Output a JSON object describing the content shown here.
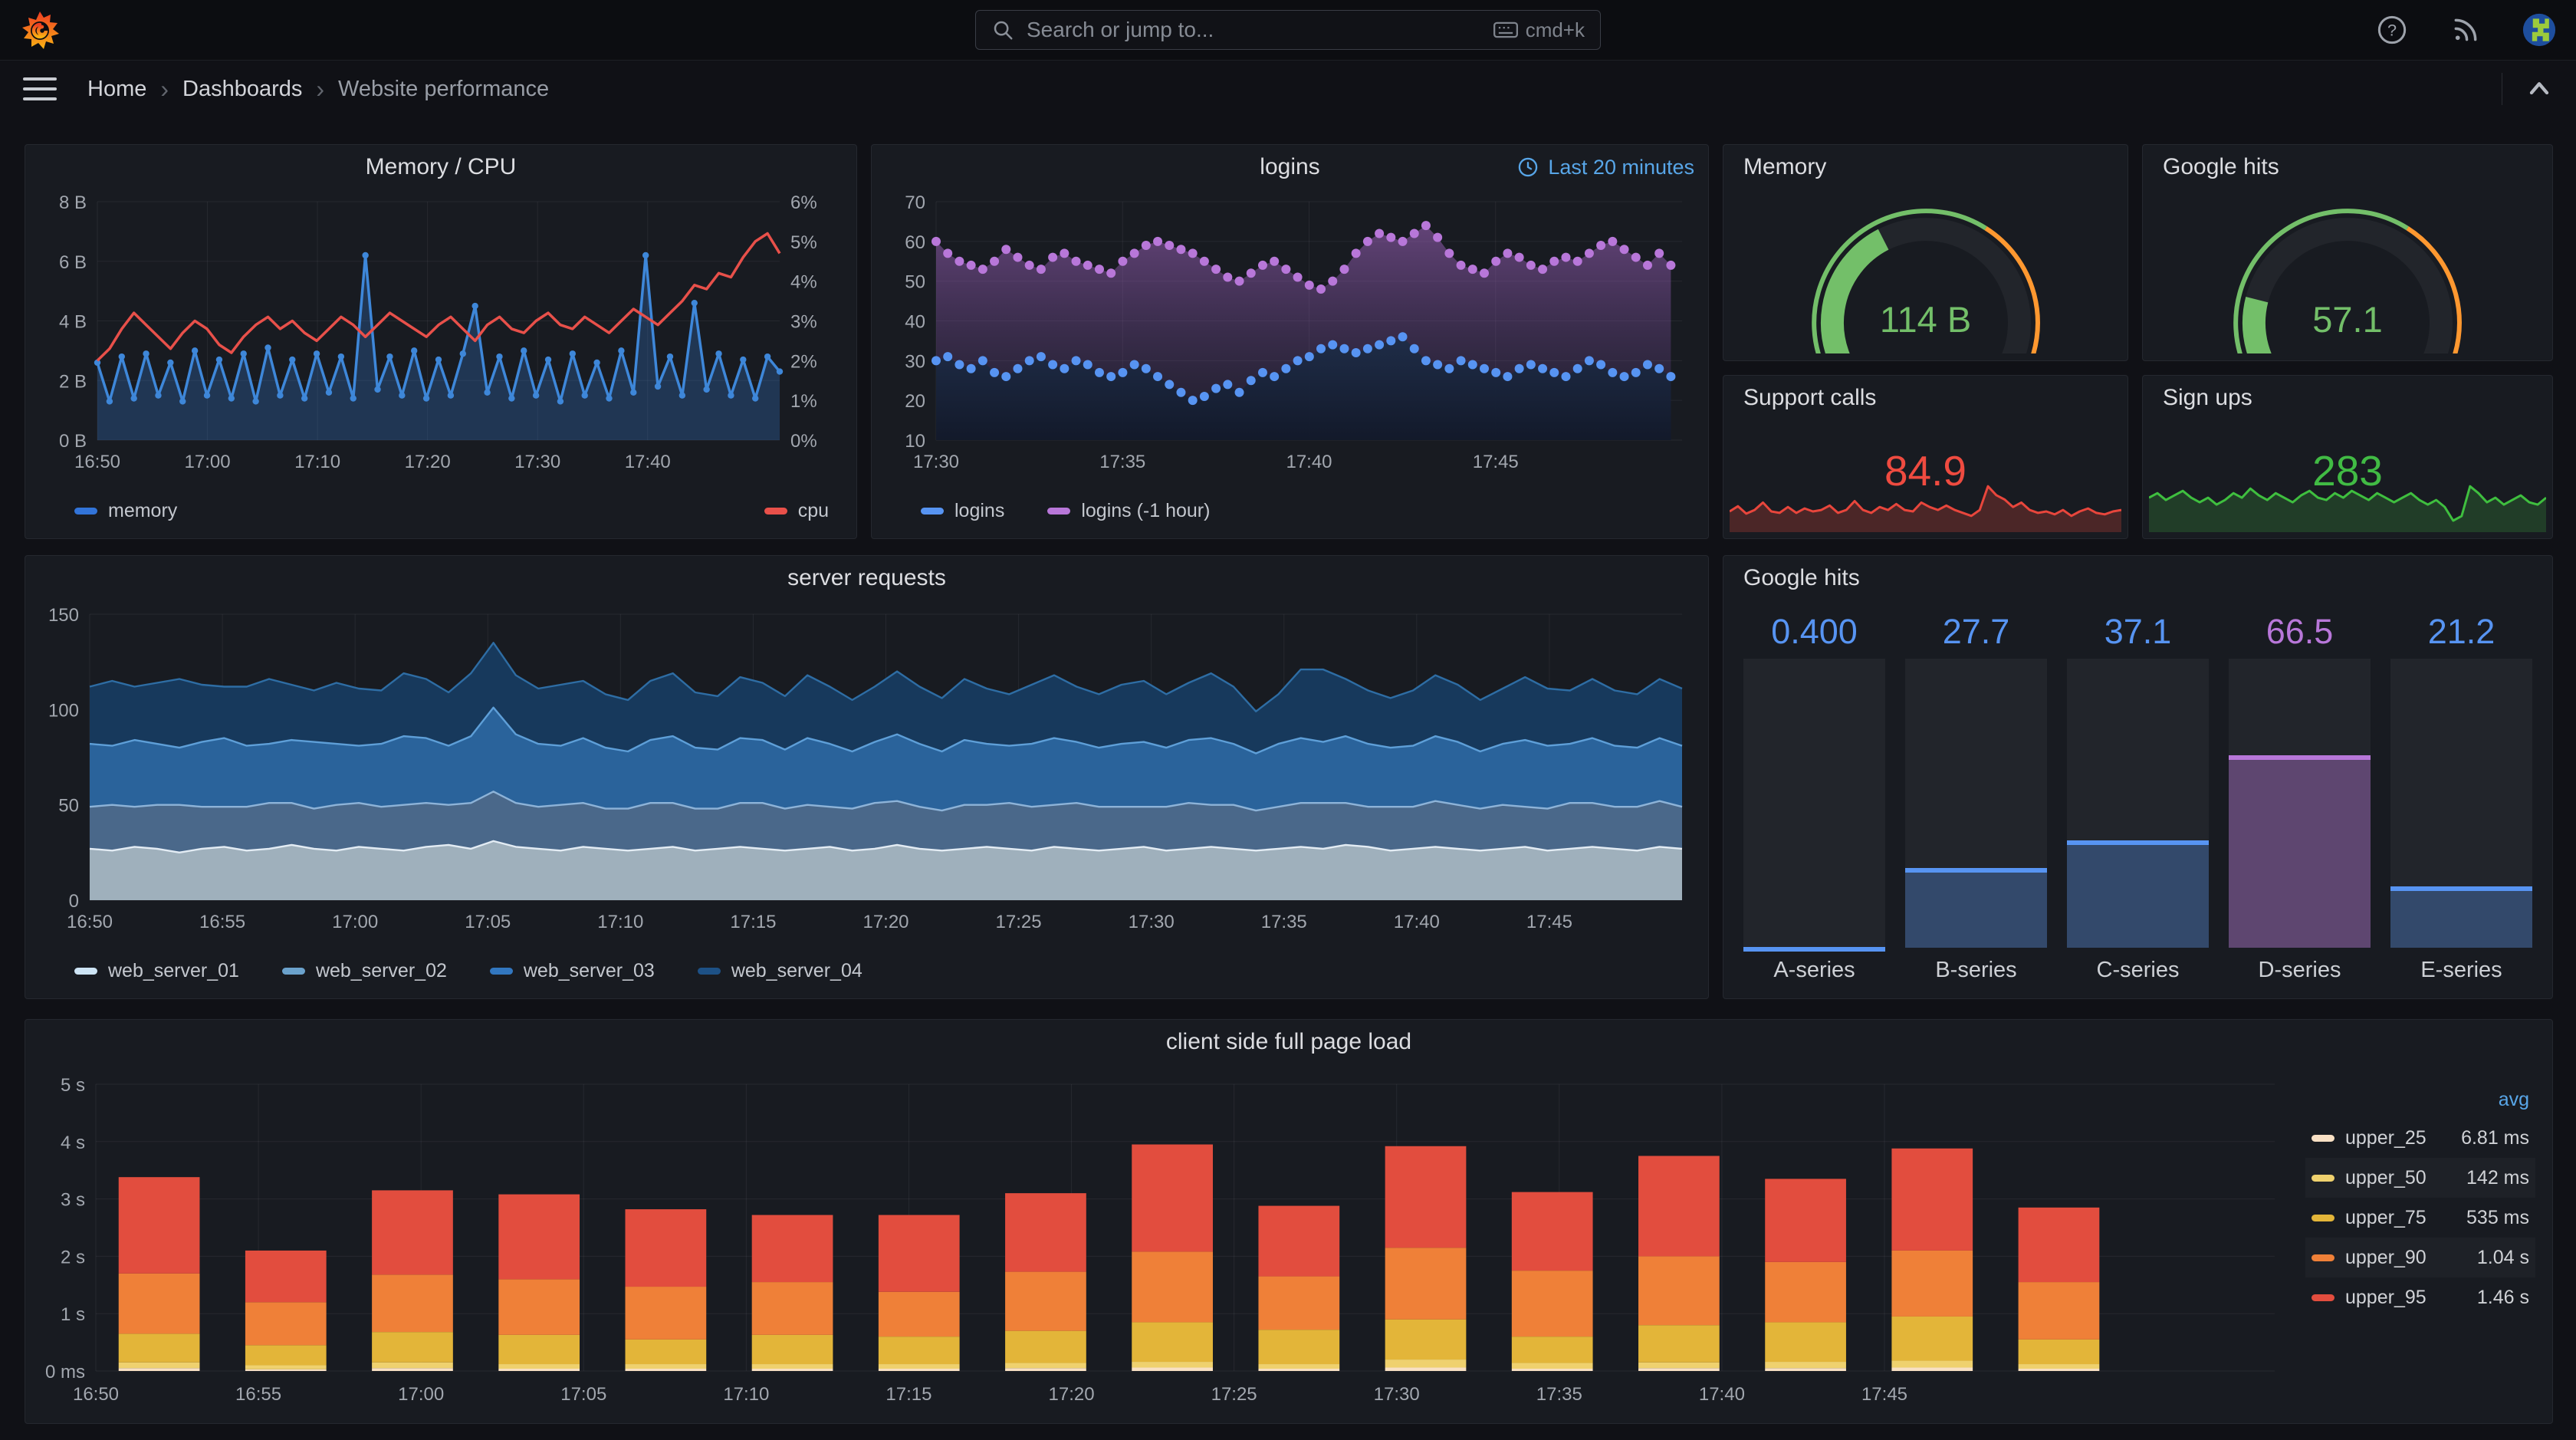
{
  "nav": {
    "search_placeholder": "Search or jump to...",
    "shortcut": "cmd+k",
    "icons": [
      "grafana-logo",
      "help-icon",
      "rss-icon",
      "avatar"
    ]
  },
  "breadcrumb": {
    "items": [
      "Home",
      "Dashboards",
      "Website performance"
    ]
  },
  "colors": {
    "accent_blue": "#58a6e8",
    "green": "#73bf69",
    "orange": "#ff9830",
    "red": "#f2495c",
    "stat_red": "#ef4b40",
    "stat_green": "#41bb44",
    "series_blue": "#5794f2",
    "series_purple": "#b877d9",
    "panel_bg": "#181b21",
    "page_bg": "#101116"
  },
  "chart_data": [
    {
      "id": "memory_cpu",
      "type": "line",
      "title": "Memory / CPU",
      "x_ticks": [
        "16:50",
        "17:00",
        "17:10",
        "17:20",
        "17:30",
        "17:40"
      ],
      "x_tick_minutes": [
        0,
        10,
        20,
        30,
        40,
        50
      ],
      "x_domain_minutes": 62,
      "left_axis": {
        "ticks": [
          "0 B",
          "2 B",
          "4 B",
          "6 B",
          "8 B"
        ],
        "range": [
          0,
          8
        ]
      },
      "right_axis": {
        "ticks": [
          "0%",
          "1%",
          "2%",
          "3%",
          "4%",
          "5%",
          "6%"
        ],
        "range": [
          0,
          6
        ]
      },
      "series": [
        {
          "name": "memory",
          "color": "#3e87d9",
          "axis": "left",
          "values": [
            2.6,
            1.3,
            2.8,
            1.4,
            2.9,
            1.5,
            2.6,
            1.3,
            3.0,
            1.5,
            2.7,
            1.4,
            2.9,
            1.3,
            3.1,
            1.5,
            2.7,
            1.4,
            2.9,
            1.6,
            2.8,
            1.4,
            6.2,
            1.7,
            2.8,
            1.5,
            3.0,
            1.4,
            2.7,
            1.5,
            2.9,
            4.5,
            1.6,
            2.8,
            1.4,
            3.0,
            1.5,
            2.7,
            1.3,
            2.9,
            1.5,
            2.6,
            1.4,
            3.0,
            1.6,
            6.2,
            1.8,
            2.8,
            1.5,
            4.6,
            1.7,
            2.9,
            1.5,
            2.7,
            1.4,
            2.8,
            2.3
          ]
        },
        {
          "name": "cpu",
          "color": "#e8504a",
          "axis": "right",
          "values": [
            2.0,
            2.3,
            2.8,
            3.2,
            2.9,
            2.6,
            2.3,
            2.7,
            3.0,
            2.8,
            2.4,
            2.2,
            2.6,
            2.9,
            3.1,
            2.8,
            3.0,
            2.7,
            2.5,
            2.8,
            3.1,
            2.9,
            2.6,
            2.9,
            3.2,
            3.0,
            2.8,
            2.6,
            2.9,
            3.1,
            2.8,
            2.5,
            2.9,
            3.1,
            2.8,
            2.7,
            3.0,
            3.2,
            2.9,
            2.8,
            3.1,
            2.9,
            2.7,
            3.0,
            3.3,
            3.1,
            2.9,
            3.2,
            3.5,
            3.9,
            3.8,
            4.2,
            4.1,
            4.6,
            5.0,
            5.2,
            4.7
          ]
        }
      ]
    },
    {
      "id": "logins",
      "type": "scatter-area",
      "title": "logins",
      "time_range_label": "Last 20 minutes",
      "x_ticks": [
        "17:30",
        "17:35",
        "17:40",
        "17:45"
      ],
      "x_tick_minutes": [
        0,
        5,
        10,
        15
      ],
      "x_domain_minutes": 20,
      "y_axis": {
        "ticks": [
          "10",
          "20",
          "30",
          "40",
          "50",
          "60",
          "70"
        ],
        "range": [
          10,
          70
        ]
      },
      "series": [
        {
          "name": "logins",
          "color": "#5794f2",
          "values": [
            30,
            31,
            29,
            28,
            30,
            27,
            26,
            28,
            30,
            31,
            29,
            28,
            30,
            29,
            27,
            26,
            27,
            29,
            28,
            26,
            24,
            22,
            20,
            21,
            23,
            24,
            22,
            25,
            27,
            26,
            28,
            30,
            31,
            33,
            34,
            33,
            32,
            33,
            34,
            35,
            36,
            33,
            30,
            29,
            28,
            30,
            29,
            28,
            27,
            26,
            28,
            29,
            28,
            27,
            26,
            28,
            30,
            29,
            27,
            26,
            27,
            29,
            28,
            26
          ]
        },
        {
          "name": "logins (-1 hour)",
          "color": "#b877d9",
          "values": [
            60,
            57,
            55,
            54,
            53,
            55,
            58,
            56,
            54,
            53,
            56,
            57,
            55,
            54,
            53,
            52,
            55,
            57,
            59,
            60,
            59,
            58,
            57,
            55,
            53,
            51,
            50,
            52,
            54,
            55,
            53,
            51,
            49,
            48,
            50,
            53,
            57,
            60,
            62,
            61,
            60,
            62,
            64,
            61,
            57,
            54,
            53,
            52,
            55,
            57,
            56,
            54,
            53,
            55,
            56,
            55,
            57,
            59,
            60,
            58,
            56,
            54,
            57,
            54
          ]
        }
      ]
    },
    {
      "id": "server_requests",
      "type": "area-stacked",
      "title": "server requests",
      "x_ticks": [
        "16:50",
        "16:55",
        "17:00",
        "17:05",
        "17:10",
        "17:15",
        "17:20",
        "17:25",
        "17:30",
        "17:35",
        "17:40",
        "17:45"
      ],
      "x_tick_minutes": [
        0,
        5,
        10,
        15,
        20,
        25,
        30,
        35,
        40,
        45,
        50,
        55
      ],
      "x_domain_minutes": 60,
      "y_axis": {
        "ticks": [
          "0",
          "50",
          "100",
          "150"
        ],
        "range": [
          0,
          150
        ]
      },
      "series": [
        {
          "name": "web_server_01",
          "color": "#9fb0bc",
          "edge": "#e3ecf4",
          "values": [
            27,
            26,
            28,
            27,
            25,
            27,
            28,
            26,
            27,
            29,
            27,
            26,
            28,
            27,
            26,
            28,
            29,
            27,
            31,
            28,
            27,
            26,
            28,
            27,
            26,
            27,
            28,
            26,
            27,
            28,
            27,
            26,
            27,
            28,
            26,
            27,
            29,
            27,
            26,
            27,
            28,
            27,
            26,
            28,
            27,
            26,
            27,
            28,
            26,
            27,
            28,
            27,
            26,
            27,
            28,
            27,
            29,
            28,
            26,
            27,
            28,
            27,
            26,
            27,
            28,
            26,
            27,
            28,
            27,
            26,
            28,
            27
          ]
        },
        {
          "name": "web_server_02",
          "color": "#4a688a",
          "edge": "#8db3d8",
          "values": [
            22,
            24,
            21,
            23,
            25,
            22,
            21,
            23,
            24,
            22,
            21,
            24,
            23,
            22,
            24,
            23,
            21,
            24,
            26,
            23,
            22,
            24,
            23,
            21,
            22,
            24,
            23,
            22,
            21,
            23,
            24,
            22,
            23,
            21,
            22,
            24,
            23,
            22,
            21,
            23,
            22,
            24,
            23,
            22,
            24,
            23,
            22,
            21,
            23,
            24,
            22,
            23,
            21,
            22,
            23,
            24,
            22,
            21,
            23,
            22,
            24,
            23,
            22,
            23,
            21,
            22,
            24,
            23,
            22,
            23,
            24,
            22
          ]
        },
        {
          "name": "web_server_03",
          "color": "#2a639b",
          "edge": "#5e9fd8",
          "values": [
            33,
            31,
            35,
            32,
            30,
            34,
            36,
            32,
            31,
            33,
            35,
            32,
            30,
            33,
            36,
            34,
            31,
            35,
            44,
            36,
            33,
            31,
            34,
            32,
            30,
            33,
            35,
            32,
            31,
            34,
            33,
            31,
            35,
            33,
            30,
            32,
            35,
            33,
            31,
            34,
            32,
            30,
            33,
            35,
            32,
            31,
            33,
            34,
            31,
            33,
            35,
            32,
            30,
            33,
            34,
            32,
            35,
            33,
            31,
            32,
            34,
            33,
            30,
            32,
            35,
            33,
            31,
            34,
            32,
            31,
            33,
            32
          ]
        },
        {
          "name": "web_server_04",
          "color": "#17395c",
          "edge": "#2e6da4",
          "values": [
            30,
            34,
            28,
            32,
            36,
            30,
            27,
            31,
            34,
            29,
            27,
            32,
            30,
            28,
            33,
            31,
            28,
            33,
            34,
            31,
            29,
            32,
            30,
            28,
            27,
            31,
            33,
            29,
            28,
            32,
            30,
            28,
            33,
            30,
            27,
            29,
            33,
            30,
            28,
            32,
            29,
            27,
            31,
            33,
            29,
            28,
            31,
            32,
            28,
            30,
            34,
            30,
            22,
            26,
            36,
            38,
            30,
            28,
            26,
            29,
            32,
            30,
            27,
            29,
            33,
            30,
            28,
            31,
            29,
            28,
            31,
            30
          ]
        }
      ]
    },
    {
      "id": "google_hits_bars",
      "type": "bar-gauge",
      "title": "Google hits",
      "max": 100,
      "categories": [
        "A-series",
        "B-series",
        "C-series",
        "D-series",
        "E-series"
      ],
      "values": [
        0.4,
        27.7,
        37.1,
        66.5,
        21.2
      ],
      "display": [
        "0.400",
        "27.7",
        "37.1",
        "66.5",
        "21.2"
      ],
      "colors": [
        "#5794f2",
        "#5794f2",
        "#5794f2",
        "#b877d9",
        "#5794f2"
      ]
    },
    {
      "id": "client_load",
      "type": "bar-stacked",
      "title": "client side full page load",
      "legend_header": "avg",
      "x_ticks": [
        "16:50",
        "16:55",
        "17:00",
        "17:05",
        "17:10",
        "17:15",
        "17:20",
        "17:25",
        "17:30",
        "17:35",
        "17:40",
        "17:45"
      ],
      "x_tick_minutes": [
        0,
        5,
        10,
        15,
        20,
        25,
        30,
        35,
        40,
        45,
        50,
        55
      ],
      "x_domain_minutes": 67,
      "y_axis": {
        "ticks": [
          "0 ms",
          "1 s",
          "2 s",
          "3 s",
          "4 s",
          "5 s"
        ],
        "range": [
          0,
          5
        ]
      },
      "series": [
        {
          "name": "upper_25",
          "avg": "6.81 ms",
          "color": "#f8e0c4"
        },
        {
          "name": "upper_50",
          "avg": "142 ms",
          "color": "#efd16e"
        },
        {
          "name": "upper_75",
          "avg": "535 ms",
          "color": "#e3b539"
        },
        {
          "name": "upper_90",
          "avg": "1.04 s",
          "color": "#ef8038"
        },
        {
          "name": "upper_95",
          "avg": "1.46 s",
          "color": "#e24d3e"
        }
      ],
      "bars_cumulative": [
        [
          0.05,
          0.15,
          0.65,
          1.7,
          3.38
        ],
        [
          0.03,
          0.1,
          0.45,
          1.2,
          2.1
        ],
        [
          0.05,
          0.15,
          0.68,
          1.68,
          3.15
        ],
        [
          0.04,
          0.12,
          0.63,
          1.6,
          3.08
        ],
        [
          0.04,
          0.12,
          0.55,
          1.47,
          2.82
        ],
        [
          0.04,
          0.12,
          0.63,
          1.55,
          2.72
        ],
        [
          0.04,
          0.12,
          0.6,
          1.38,
          2.72
        ],
        [
          0.05,
          0.14,
          0.7,
          1.73,
          3.1
        ],
        [
          0.06,
          0.16,
          0.85,
          2.08,
          3.95
        ],
        [
          0.04,
          0.12,
          0.72,
          1.65,
          2.88
        ],
        [
          0.06,
          0.2,
          0.9,
          2.15,
          3.92
        ],
        [
          0.04,
          0.14,
          0.6,
          1.75,
          3.12
        ],
        [
          0.05,
          0.15,
          0.8,
          2.0,
          3.75
        ],
        [
          0.05,
          0.16,
          0.85,
          1.9,
          3.35
        ],
        [
          0.06,
          0.18,
          0.95,
          2.1,
          3.88
        ],
        [
          0.04,
          0.12,
          0.55,
          1.55,
          2.85
        ]
      ]
    },
    {
      "id": "support_calls",
      "type": "stat-sparkline",
      "title": "Support calls",
      "display": "84.9",
      "color": "#ef4b40",
      "values": [
        28,
        35,
        25,
        30,
        40,
        28,
        26,
        34,
        26,
        32,
        28,
        30,
        36,
        26,
        30,
        42,
        30,
        26,
        34,
        30,
        38,
        30,
        28,
        40,
        34,
        30,
        36,
        30,
        26,
        22,
        30,
        62,
        50,
        44,
        34,
        40,
        30,
        26,
        28,
        24,
        30,
        22,
        28,
        32,
        26,
        24,
        28,
        30
      ]
    },
    {
      "id": "sign_ups",
      "type": "stat-sparkline",
      "title": "Sign ups",
      "display": "283",
      "color": "#41bb44",
      "values": [
        30,
        34,
        28,
        32,
        36,
        30,
        26,
        30,
        24,
        28,
        34,
        30,
        38,
        32,
        28,
        34,
        30,
        26,
        32,
        36,
        30,
        28,
        34,
        30,
        36,
        32,
        28,
        34,
        30,
        26,
        30,
        34,
        28,
        24,
        28,
        22,
        10,
        14,
        40,
        34,
        26,
        30,
        24,
        28,
        32,
        26,
        24,
        30
      ]
    },
    {
      "id": "memory_gauge",
      "type": "gauge",
      "title": "Memory",
      "display": "114 B",
      "fraction": 0.4,
      "value_color": "#73bf69",
      "thresholds": [
        {
          "color": "#73bf69",
          "to": 0.62
        },
        {
          "color": "#ff9830",
          "to": 0.94
        },
        {
          "color": "#f2495c",
          "to": 1
        }
      ]
    },
    {
      "id": "google_hits_gauge",
      "type": "gauge",
      "title": "Google hits",
      "display": "57.1",
      "fraction": 0.22,
      "value_color": "#73bf69",
      "thresholds": [
        {
          "color": "#73bf69",
          "to": 0.62
        },
        {
          "color": "#ff9830",
          "to": 0.94
        },
        {
          "color": "#f2495c",
          "to": 1
        }
      ]
    }
  ]
}
